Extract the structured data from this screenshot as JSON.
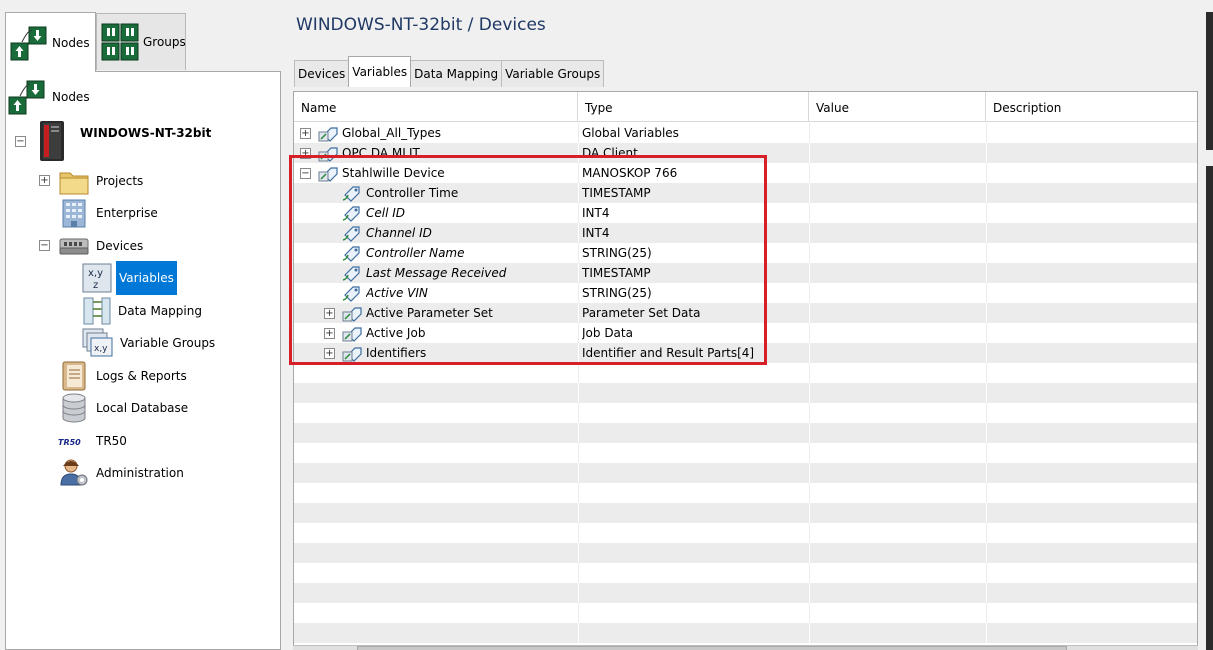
{
  "left_tabs": [
    {
      "label": "Nodes",
      "icon": "nodes-icon"
    },
    {
      "label": "Groups",
      "icon": "groups-icon"
    }
  ],
  "tree": {
    "root": "Nodes",
    "device_node": "WINDOWS-NT-32bit",
    "items": [
      {
        "label": "Projects",
        "icon": "folder-icon"
      },
      {
        "label": "Enterprise",
        "icon": "building-icon"
      },
      {
        "label": "Devices",
        "icon": "devices-icon"
      },
      {
        "label": "Variables",
        "icon": "variables-icon"
      },
      {
        "label": "Data Mapping",
        "icon": "data-mapping-icon"
      },
      {
        "label": "Variable Groups",
        "icon": "variable-groups-icon"
      },
      {
        "label": "Logs & Reports",
        "icon": "notebook-icon"
      },
      {
        "label": "Local Database",
        "icon": "database-icon"
      },
      {
        "label": "TR50",
        "icon": "tr50-icon"
      },
      {
        "label": "Administration",
        "icon": "admin-user-icon"
      }
    ],
    "tr50_logo": "TR50",
    "selected": "Variables"
  },
  "page_title": "WINDOWS-NT-32bit / Devices",
  "right_tabs": [
    "Devices",
    "Variables",
    "Data Mapping",
    "Variable Groups"
  ],
  "active_tab": "Variables",
  "grid": {
    "columns": [
      "Name",
      "Type",
      "Value",
      "Description"
    ],
    "rows": [
      {
        "name": "Global_All_Types",
        "type": "Global Variables",
        "expander": "+",
        "indent": 0,
        "italic": false
      },
      {
        "name": "OPC DA MLIT",
        "type": "DA Client",
        "expander": "+",
        "indent": 0,
        "italic": false
      },
      {
        "name": "Stahlwille Device",
        "type": "MANOSKOP 766",
        "expander": "−",
        "indent": 0,
        "italic": false
      },
      {
        "name": "Controller Time",
        "type": "TIMESTAMP",
        "expander": "",
        "indent": 1,
        "italic": false
      },
      {
        "name": "Cell ID",
        "type": "INT4",
        "expander": "",
        "indent": 1,
        "italic": true
      },
      {
        "name": "Channel ID",
        "type": "INT4",
        "expander": "",
        "indent": 1,
        "italic": true
      },
      {
        "name": "Controller Name",
        "type": "STRING(25)",
        "expander": "",
        "indent": 1,
        "italic": true
      },
      {
        "name": "Last Message Received",
        "type": "TIMESTAMP",
        "expander": "",
        "indent": 1,
        "italic": true
      },
      {
        "name": "Active VIN",
        "type": "STRING(25)",
        "expander": "",
        "indent": 1,
        "italic": true
      },
      {
        "name": "Active Parameter Set",
        "type": "Parameter Set Data",
        "expander": "+",
        "indent": 1,
        "italic": false
      },
      {
        "name": "Active Job",
        "type": "Job Data",
        "expander": "+",
        "indent": 1,
        "italic": false
      },
      {
        "name": "Identifiers",
        "type": "Identifier and Result Parts[4]",
        "expander": "+",
        "indent": 1,
        "italic": false
      }
    ]
  },
  "colors": {
    "title": "#1f3864",
    "selection": "#0078d7",
    "highlight_box": "#d61f26",
    "row_alt": "#ececec"
  }
}
